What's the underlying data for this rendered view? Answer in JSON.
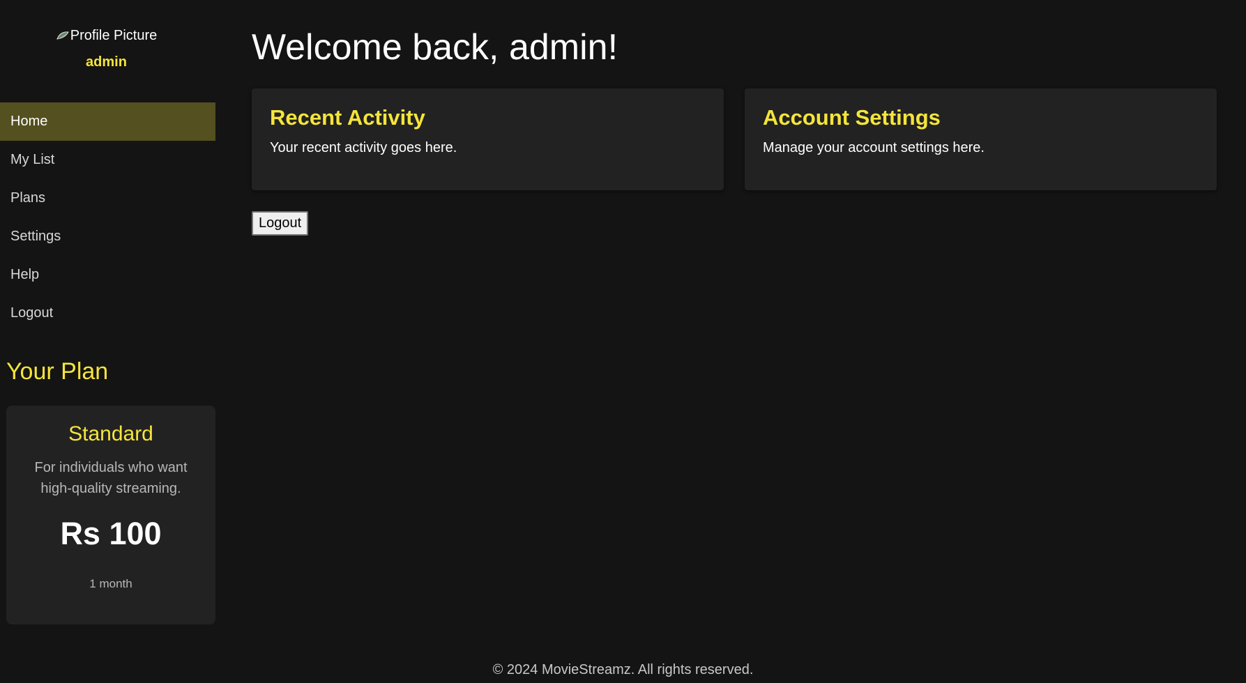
{
  "sidebar": {
    "profile": {
      "image_alt": "Profile Picture",
      "username": "admin"
    },
    "nav": [
      {
        "label": "Home",
        "active": true
      },
      {
        "label": "My List",
        "active": false
      },
      {
        "label": "Plans",
        "active": false
      },
      {
        "label": "Settings",
        "active": false
      },
      {
        "label": "Help",
        "active": false
      },
      {
        "label": "Logout",
        "active": false
      }
    ],
    "plan_heading": "Your Plan",
    "plan": {
      "name": "Standard",
      "description": "For individuals who want high-quality streaming.",
      "price": "Rs 100",
      "duration": "1 month"
    }
  },
  "main": {
    "welcome": "Welcome back, admin!",
    "cards": [
      {
        "title": "Recent Activity",
        "text": "Your recent activity goes here."
      },
      {
        "title": "Account Settings",
        "text": "Manage your account settings here."
      }
    ],
    "logout_label": "Logout"
  },
  "footer": {
    "text": "© 2024 MovieStreamz. All rights reserved."
  },
  "colors": {
    "background": "#141414",
    "accent": "#f5e53b",
    "active_nav": "#545020",
    "card": "#222222"
  },
  "icons": {
    "profile_image": "broken-image-icon"
  }
}
